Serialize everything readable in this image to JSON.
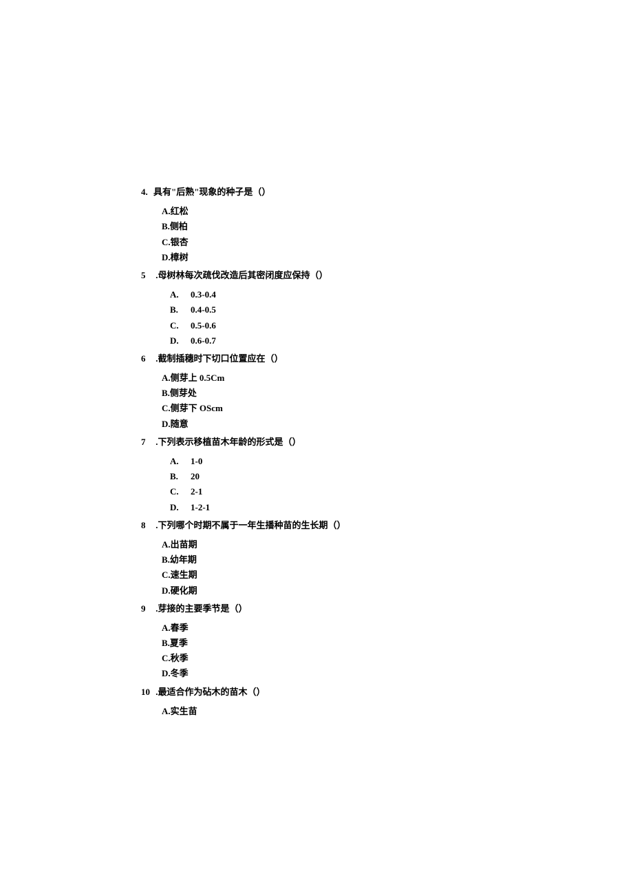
{
  "questions": [
    {
      "number": "4.",
      "stem": "具有\"后熟\"现象的种子是（）",
      "inset": "narrow",
      "options": [
        {
          "letter": "A.",
          "text": "红松"
        },
        {
          "letter": "B.",
          "text": "侧柏"
        },
        {
          "letter": "C.",
          "text": "银杏"
        },
        {
          "letter": "D.",
          "text": "樟树"
        }
      ]
    },
    {
      "number": "5",
      "stem": " .母树林每次疏伐改造后其密闭度应保持（）",
      "inset": "wide",
      "options": [
        {
          "letter": "A.",
          "text": "0.3-0.4"
        },
        {
          "letter": "B.",
          "text": "0.4-0.5"
        },
        {
          "letter": "C.",
          "text": "0.5-0.6"
        },
        {
          "letter": "D.",
          "text": "0.6-0.7"
        }
      ]
    },
    {
      "number": "6",
      "stem": " .截制插穗时下切口位置应在（）",
      "inset": "narrow",
      "options": [
        {
          "letter": "A.",
          "text": "侧芽上 0.5Cm"
        },
        {
          "letter": "B.",
          "text": "侧芽处"
        },
        {
          "letter": "C.",
          "text": "侧芽下 OScm"
        },
        {
          "letter": "D.",
          "text": "随意"
        }
      ]
    },
    {
      "number": "7",
      "stem": " .下列表示移植苗木年龄的形式是（）",
      "inset": "wide",
      "options": [
        {
          "letter": "A.",
          "text": "1-0"
        },
        {
          "letter": "B.",
          "text": "20"
        },
        {
          "letter": "C.",
          "text": "2-1"
        },
        {
          "letter": "D.",
          "text": "1-2-1"
        }
      ]
    },
    {
      "number": "8",
      "stem": " .下列哪个时期不属于一年生播种苗的生长期（）",
      "inset": "narrow",
      "options": [
        {
          "letter": "A.",
          "text": "出苗期"
        },
        {
          "letter": "B.",
          "text": "幼年期"
        },
        {
          "letter": "C.",
          "text": "速生期"
        },
        {
          "letter": "D.",
          "text": "硬化期"
        }
      ]
    },
    {
      "number": "9",
      "stem": " .芽接的主要季节是（）",
      "inset": "narrow",
      "options": [
        {
          "letter": "A.",
          "text": "春季"
        },
        {
          "letter": "B.",
          "text": "夏季"
        },
        {
          "letter": "C.",
          "text": "秋季"
        },
        {
          "letter": "D.",
          "text": "冬季"
        }
      ]
    },
    {
      "number": "10",
      "stem": " .最适合作为砧木的苗木（）",
      "inset": "narrow",
      "options": [
        {
          "letter": "A.",
          "text": "实生苗"
        }
      ]
    }
  ]
}
